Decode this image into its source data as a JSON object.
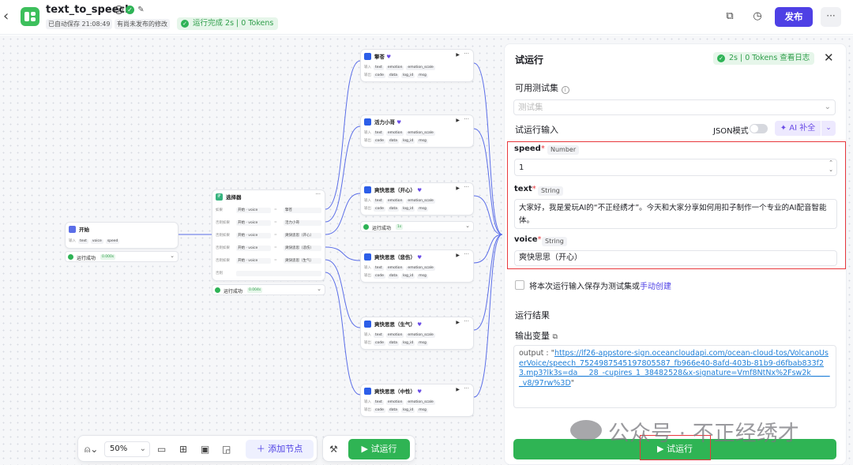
{
  "header": {
    "title": "text_to_speech",
    "saved": "已自动保存 21:08:49",
    "unpublished": "有尚未发布的修改",
    "run_status": "运行完成 2s | 0 Tokens",
    "publish": "发布"
  },
  "nodes": {
    "start": {
      "title": "开始",
      "in_label": "输入",
      "params": [
        "text",
        "voice",
        "speed"
      ],
      "status": "运行成功",
      "time": "0.000s"
    },
    "selector": {
      "title": "选择器",
      "rows": [
        {
          "label": "如果",
          "src": "开始",
          "var": "voice",
          "op": "=",
          "val": "擎苍"
        },
        {
          "label": "否则如果",
          "src": "开始",
          "var": "voice",
          "op": "=",
          "val": "活力小哥"
        },
        {
          "label": "否则如果",
          "src": "开始",
          "var": "voice",
          "op": "=",
          "val": "爽快思思（开心）"
        },
        {
          "label": "否则如果",
          "src": "开始",
          "var": "voice",
          "op": "=",
          "val": "爽快思思（悲伤）"
        },
        {
          "label": "否则如果",
          "src": "开始",
          "var": "voice",
          "op": "=",
          "val": "爽快思思（生气）"
        }
      ],
      "else_label": "否则",
      "status": "运行成功",
      "time": "0.004s"
    },
    "tts": [
      {
        "title": "擎苍"
      },
      {
        "title": "活力小哥"
      },
      {
        "title": "爽快思思（开心）"
      },
      {
        "title": "爽快思思（悲伤）"
      },
      {
        "title": "爽快思思（生气）"
      },
      {
        "title": "爽快思思（中性）"
      }
    ],
    "tts_in_label": "输入",
    "tts_out_label": "输出",
    "tts_inputs": [
      "text",
      "emotion",
      "emotion_scale"
    ],
    "tts_outputs": [
      "code",
      "data",
      "log_id",
      "msg"
    ],
    "tts_ok": {
      "status": "运行成功",
      "time": "1s"
    }
  },
  "toolbar": {
    "zoom": "50%",
    "add_node": "添加节点",
    "test_run": "试运行"
  },
  "panel": {
    "title": "试运行",
    "tokens": "2s | 0 Tokens  查看日志",
    "test_set_label": "可用测试集",
    "test_set_placeholder": "测试集",
    "run_input_label": "试运行输入",
    "json_mode": "JSON模式",
    "ai_fill": "AI 补全",
    "fields": [
      {
        "name": "speed",
        "type": "Number",
        "value": "1"
      },
      {
        "name": "text",
        "type": "String",
        "value": "大家好，我是爱玩AI的“不正经绣才”。今天和大家分享如何用扣子制作一个专业的AI配音智能体。"
      },
      {
        "name": "voice",
        "type": "String",
        "value": "爽快思思（开心）"
      }
    ],
    "save_text": "将本次运行输入保存为测试集或",
    "save_link": "手动创建",
    "result_label": "运行结果",
    "output_label": "输出变量",
    "output_prefix": "output : \"",
    "output_url": "https://lf26-appstore-sign.oceancloudapi.com/ocean-cloud-tos/VolcanoUserVoice/speech_7524987545197805587_fb966e40-8afd-403b-81b9-d6fbab833f23.mp3?lk3s=da___28_-cupires_1_38482528&x-signature=Vmf8NtNx%2Fsw2k______v8/97rw%3D",
    "output_suffix": "\"",
    "run_button": "试运行"
  },
  "watermark": "公众号 · 不正经绣才"
}
